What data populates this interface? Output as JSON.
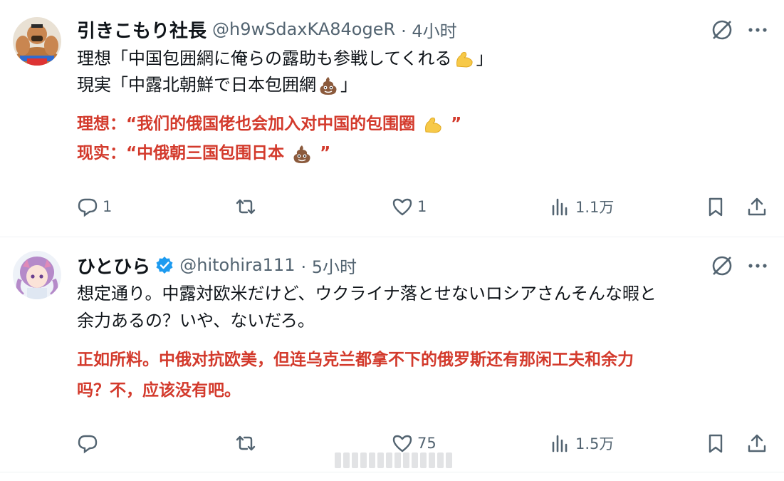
{
  "tweets": [
    {
      "author": "引きこもり社長",
      "handle": "@h9wSdaxKA84ogeR",
      "time": "· 4小时",
      "text_lines": [
        "理想「中国包囲網に俺らの露助も参戦してくれる",
        "現実「中露北朝鮮で日本包囲網"
      ],
      "text_suffix": "」",
      "translation_lines": [
        "理想：“我们的俄国佬也会加入对中国的包围圈",
        "现实：“中俄朝三国包围日本"
      ],
      "translation_suffix": "”",
      "emojis": [
        "flexed-biceps-emoji",
        "pile-of-poo-emoji"
      ],
      "replies": "1",
      "retweets": "",
      "likes": "1",
      "views": "1.1万"
    },
    {
      "author": "ひとひら",
      "handle": "@hitohira111",
      "time": "· 5小时",
      "verified": true,
      "text_lines": [
        "想定通り。中露対欧米だけど、ウクライナ落とせないロシアさんそんな暇と",
        "余力あるの？いや、ないだろ。"
      ],
      "translation_lines": [
        "正如所料。中俄对抗欧美，但连乌克兰都拿不下的俄罗斯还有那闲工夫和余力",
        "吗？不，应该没有吧。"
      ],
      "replies": "",
      "retweets": "",
      "likes": "75",
      "views": "1.5万"
    }
  ],
  "colors": {
    "text": "#0f1419",
    "secondary": "#536471",
    "translation": "#d33a2c",
    "verified": "#1d9bf0",
    "divider": "#eff3f4"
  }
}
